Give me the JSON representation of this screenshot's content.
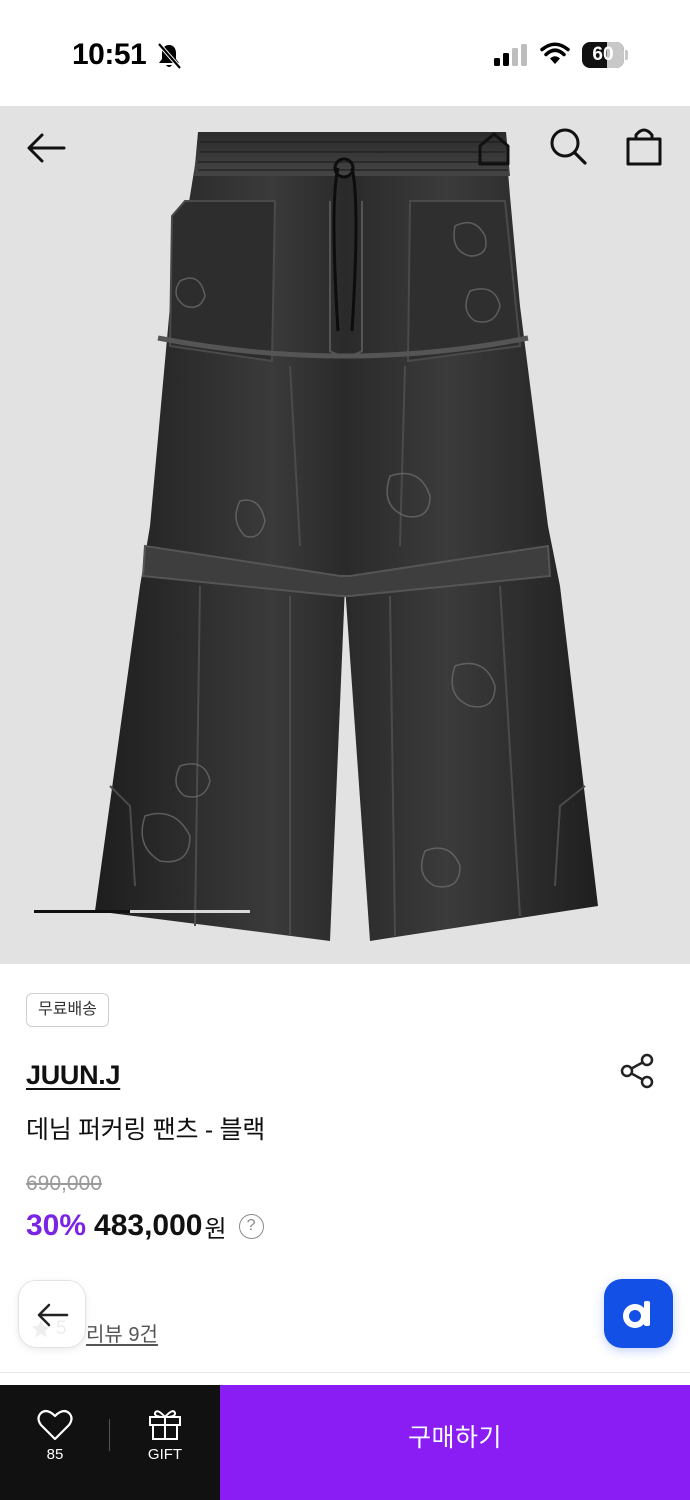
{
  "status_bar": {
    "time": "10:51",
    "battery": "60"
  },
  "nav": {
    "back_icon": "arrow-left-icon",
    "home_icon": "home-icon",
    "search_icon": "search-icon",
    "cart_icon": "shopping-bag-icon"
  },
  "product": {
    "badge": "무료배송",
    "brand": "JUUN.J",
    "name": "데님 퍼커링 팬츠 - 블랙",
    "original_price": "690,000",
    "discount": "30%",
    "price": "483,000",
    "currency": "원",
    "help": "?",
    "rating": "5",
    "review_link": "리뷰 9건",
    "carousel_progress": 0.18
  },
  "bottom_bar": {
    "like_count": "85",
    "gift_label": "GIFT",
    "buy_label": "구매하기"
  },
  "colors": {
    "accent": "#8a1cf4",
    "discount": "#7a24e6",
    "app_button": "#1250e6"
  }
}
